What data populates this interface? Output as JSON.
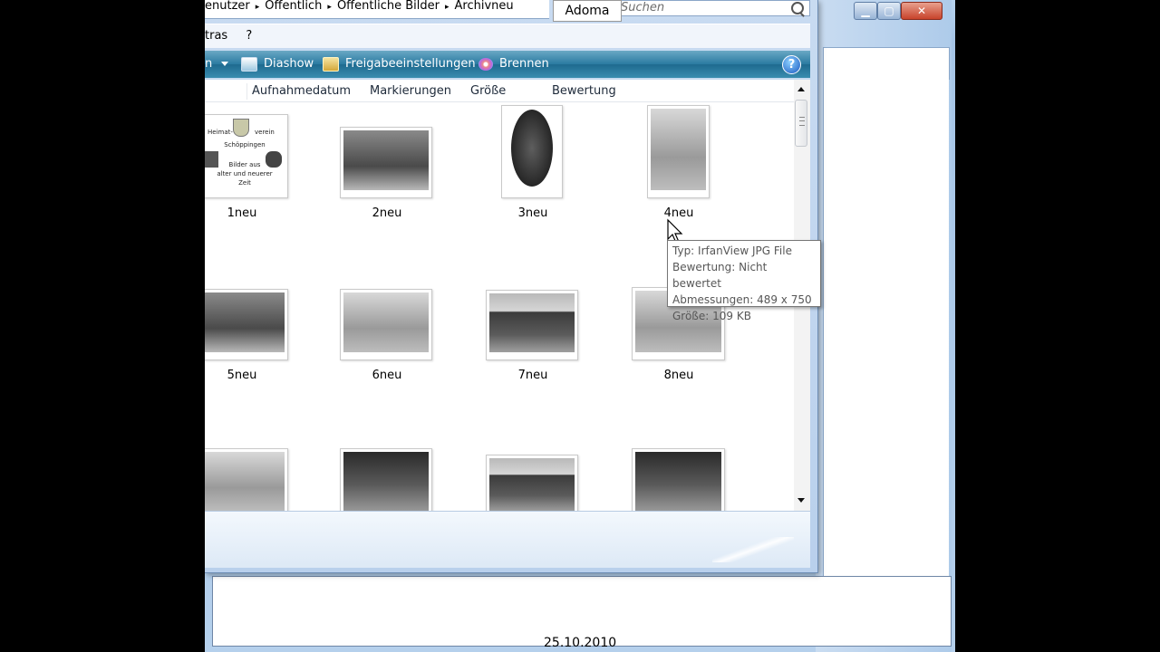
{
  "address": {
    "crumbs": [
      "enutzer",
      "Öffentlich",
      "Öffentliche Bilder",
      "Archivneu"
    ]
  },
  "adoma_label": "Adoma",
  "search": {
    "placeholder": "Suchen"
  },
  "menu": {
    "items": [
      "tras",
      "?"
    ]
  },
  "toolbar": {
    "partial": "n",
    "diashow": "Diashow",
    "freigabe": "Freigabeeinstellungen",
    "brennen": "Brennen",
    "help": "?"
  },
  "columns": [
    "Aufnahmedatum",
    "Markierungen",
    "Größe",
    "Bewertung"
  ],
  "items": [
    {
      "name": "1neu"
    },
    {
      "name": "2neu"
    },
    {
      "name": "3neu"
    },
    {
      "name": "4neu"
    },
    {
      "name": "5neu"
    },
    {
      "name": "6neu"
    },
    {
      "name": "7neu"
    },
    {
      "name": "8neu"
    }
  ],
  "flyer": {
    "line1": "Heimat-",
    "line2": "verein",
    "line3": "Schöppingen",
    "line4": "Bilder aus",
    "line5": "alter und neuerer",
    "line6": "Zeit"
  },
  "tooltip": {
    "type": "Typ: IrfanView JPG File",
    "rating": "Bewertung: Nicht bewertet",
    "dimensions": "Abmessungen: 489 x 750",
    "size": "Größe: 109 KB"
  },
  "date": "25.10.2010",
  "colors": {
    "cmdbar": "#2a7aa1",
    "background": "#b7d3ee"
  }
}
